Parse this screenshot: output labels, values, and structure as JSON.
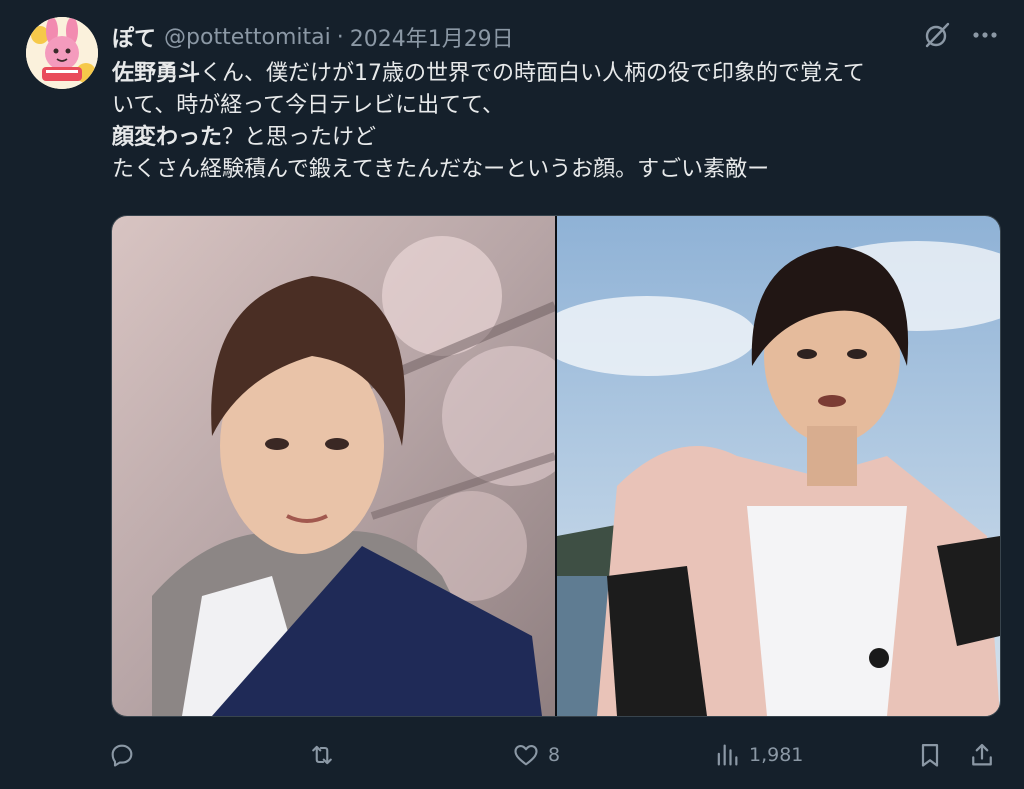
{
  "author": {
    "display_name": "ぽて",
    "handle": "@pottettomitai",
    "separator": "·",
    "date": "2024年1月29日"
  },
  "tweet": {
    "lines": [
      [
        {
          "text": "佐野勇斗",
          "bold": true
        },
        {
          "text": "くん、僕だけが17歳の世界での時面白い人柄の役で印象的で覚えて",
          "bold": false
        }
      ],
      [
        {
          "text": "いて、時が経って今日テレビに出てて、",
          "bold": false
        }
      ],
      [
        {
          "text": "顔変わった",
          "bold": true
        },
        {
          "text": "？と思ったけど",
          "bold": false
        }
      ],
      [
        {
          "text": "たくさん経験積んで鍛えてきたんだなーというお顔。すごい素敵ー",
          "bold": false
        }
      ]
    ]
  },
  "media": {
    "photos": [
      {
        "name": "photo-left",
        "description_icon": "portrait-photo"
      },
      {
        "name": "photo-right",
        "description_icon": "portrait-photo"
      }
    ]
  },
  "actions": {
    "reply_count": "",
    "retweet_count": "",
    "like_count": "8",
    "view_count": "1,981"
  },
  "icons": {
    "reply": "reply-icon",
    "retweet": "retweet-icon",
    "like": "heart-icon",
    "views": "views-icon",
    "bookmark": "bookmark-icon",
    "share": "share-icon",
    "grok": "grok-icon",
    "more": "more-icon"
  },
  "colors": {
    "background": "#15202b",
    "primary_text": "#e7e9ea",
    "secondary_text": "#8b98a5"
  }
}
